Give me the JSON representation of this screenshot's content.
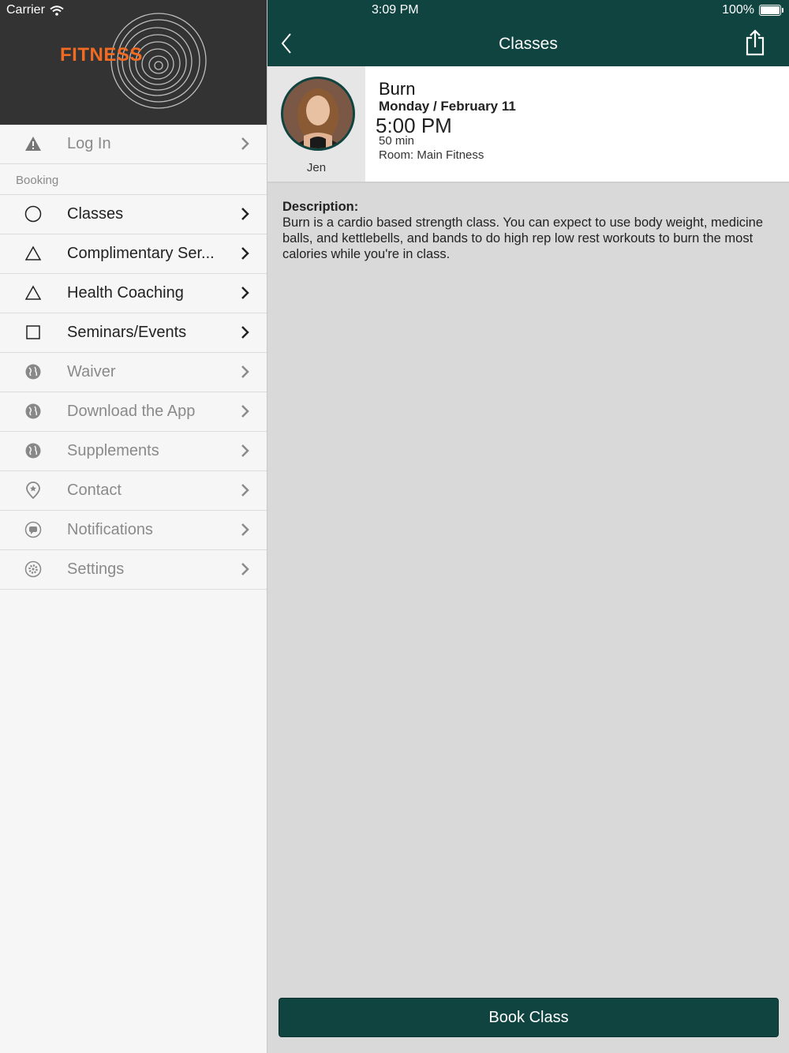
{
  "status_bar": {
    "carrier": "Carrier",
    "time": "3:09 PM",
    "battery": "100%"
  },
  "sidebar": {
    "logo_text": "FITNESS",
    "items_top": [
      {
        "label": "Log In",
        "icon": "warning-icon"
      }
    ],
    "section_label": "Booking",
    "items": [
      {
        "label": "Classes",
        "icon": "circle-icon",
        "active": true
      },
      {
        "label": "Complimentary Ser...",
        "icon": "triangle-icon",
        "active": true
      },
      {
        "label": "Health Coaching",
        "icon": "triangle-icon",
        "active": true
      },
      {
        "label": "Seminars/Events",
        "icon": "square-icon",
        "active": true
      },
      {
        "label": "Waiver",
        "icon": "globe-icon",
        "active": false
      },
      {
        "label": "Download the App",
        "icon": "globe-icon",
        "active": false
      },
      {
        "label": "Supplements",
        "icon": "globe-icon",
        "active": false
      },
      {
        "label": "Contact",
        "icon": "location-pin-icon",
        "active": false
      },
      {
        "label": "Notifications",
        "icon": "chat-bubble-icon",
        "active": false
      },
      {
        "label": "Settings",
        "icon": "gear-icon",
        "active": false
      }
    ]
  },
  "header": {
    "title": "Classes"
  },
  "class_detail": {
    "instructor": "Jen",
    "name": "Burn",
    "date": "Monday / February 11",
    "time": "5:00 PM",
    "duration": "50 min",
    "room": "Room: Main Fitness"
  },
  "description": {
    "title": "Description:",
    "text": "Burn is a cardio based strength class. You can expect to use body weight, medicine balls, and kettlebells, and bands to do high rep low rest workouts to burn the most calories while you're in class."
  },
  "actions": {
    "book_label": "Book Class"
  },
  "colors": {
    "brand": "#0f4440",
    "logo_accent": "#f26b22"
  }
}
